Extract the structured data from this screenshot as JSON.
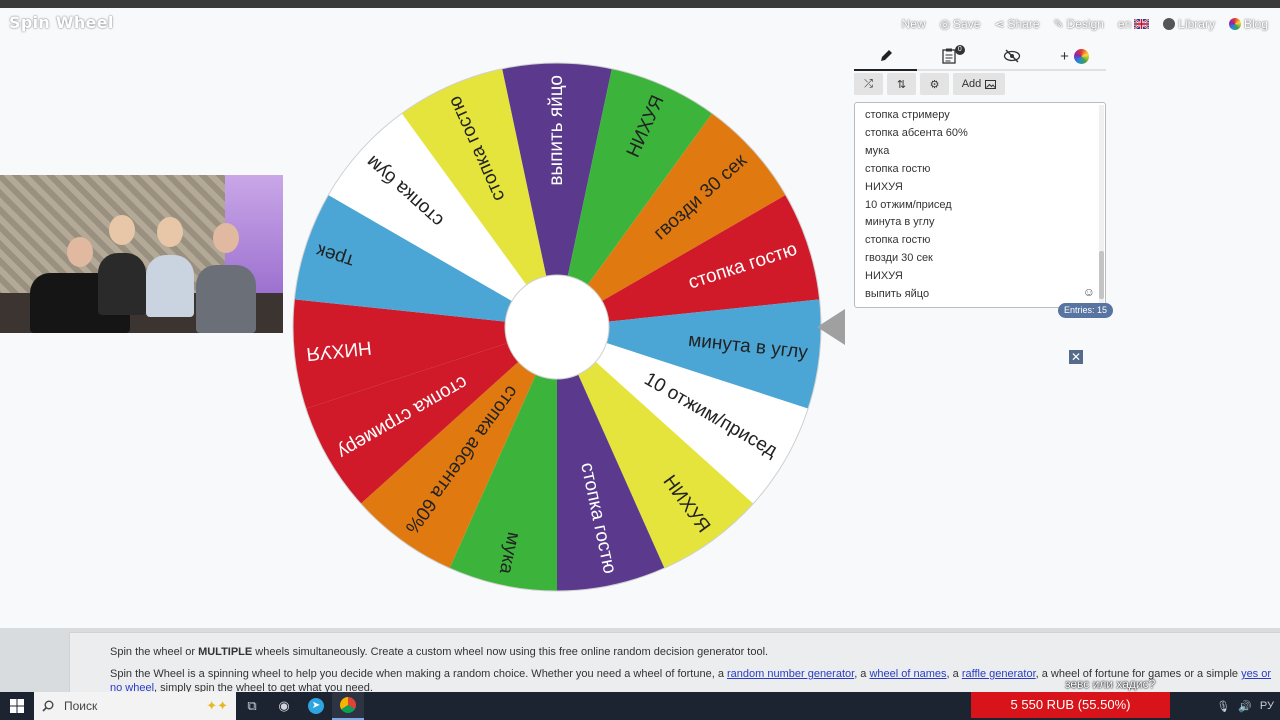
{
  "app": {
    "logo": "Spin Wheel"
  },
  "topnav": [
    {
      "label": "New",
      "icon": "none"
    },
    {
      "label": "Save",
      "icon": "save-icon"
    },
    {
      "label": "Share",
      "icon": "share-icon"
    },
    {
      "label": "Design",
      "icon": "design-icon"
    },
    {
      "label": "en",
      "icon": "uk-flag-icon"
    },
    {
      "label": "Library",
      "icon": "library-icon"
    },
    {
      "label": "Blog",
      "icon": "blog-icon"
    }
  ],
  "wheel": {
    "segments": [
      {
        "label": "выпить яйцо",
        "color": "#5b3a8e",
        "text_color": "#ffffff"
      },
      {
        "label": "НИХУЯ",
        "color": "#3cb43c",
        "text_color": "#222222"
      },
      {
        "label": "гвозди 30 сек",
        "color": "#e07a10",
        "text_color": "#222222"
      },
      {
        "label": "стопка гостю",
        "color": "#d01a2a",
        "text_color": "#ffffff"
      },
      {
        "label": "минута в углу",
        "color": "#4ba6d6",
        "text_color": "#222222"
      },
      {
        "label": "10 отжим/присед",
        "color": "#ffffff",
        "text_color": "#222222"
      },
      {
        "label": "НИХУЯ",
        "color": "#e4e43c",
        "text_color": "#222222"
      },
      {
        "label": "стопка гостю",
        "color": "#5b3a8e",
        "text_color": "#ffffff"
      },
      {
        "label": "мука",
        "color": "#3cb43c",
        "text_color": "#222222"
      },
      {
        "label": "стопка абсента 60%",
        "color": "#e07a10",
        "text_color": "#222222"
      },
      {
        "label": "стопка стримеру",
        "color": "#d01a2a",
        "text_color": "#ffffff"
      },
      {
        "label": "НИХУЯ",
        "color": "#d01a2a",
        "text_color": "#ffffff"
      },
      {
        "label": "трек",
        "color": "#4ba6d6",
        "text_color": "#222222"
      },
      {
        "label": "стопка бум",
        "color": "#ffffff",
        "text_color": "#222222"
      },
      {
        "label": "стопка гостю",
        "color": "#e4e43c",
        "text_color": "#222222"
      }
    ]
  },
  "panel": {
    "tabs": [
      {
        "name": "edit",
        "icon": "pencil-icon"
      },
      {
        "name": "results",
        "icon": "clipboard-icon",
        "badge": "0"
      },
      {
        "name": "hide",
        "icon": "eye-slash-icon"
      },
      {
        "name": "add-wheel",
        "icon": "plus-color-wheel-icon"
      }
    ],
    "toolbar": {
      "shuffle": "shuffle-icon",
      "sort": "sort-icon",
      "settings": "gear-icon",
      "add_label": "Add",
      "add_icon": "image-icon"
    },
    "entries": [
      "стопка стримеру",
      "стопка абсента 60%",
      "мука",
      "стопка гостю",
      "НИХУЯ",
      "10 отжим/присед",
      "минута в углу",
      "стопка гостю",
      "гвозди 30 сек",
      "НИХУЯ",
      "выпить яйцо"
    ],
    "entries_count": "Entries: 15"
  },
  "info": {
    "p1_prefix": "Spin the wheel or ",
    "p1_bold": "MULTIPLE",
    "p1_suffix": " wheels simultaneously. Create a custom wheel now using this free online random decision generator tool.",
    "p2_a": "Spin the Wheel is a spinning wheel to help you decide when making a random choice. Whether you need a wheel of fortune, a ",
    "link1": "random number generator",
    "p2_b": ", a ",
    "link2": "wheel of names",
    "p2_c": ", a ",
    "link3": "raffle generator",
    "p2_d": ", a wheel of fortune for games or a simple ",
    "link4": "yes or no wheel",
    "p2_e": ", simply spin the wheel to get what you need."
  },
  "taskbar": {
    "search_placeholder": "Поиск",
    "language": "РУ"
  },
  "overlay": {
    "donation_amount": "5 550 RUB (55.50%)",
    "message": "зевс или хадис?"
  }
}
